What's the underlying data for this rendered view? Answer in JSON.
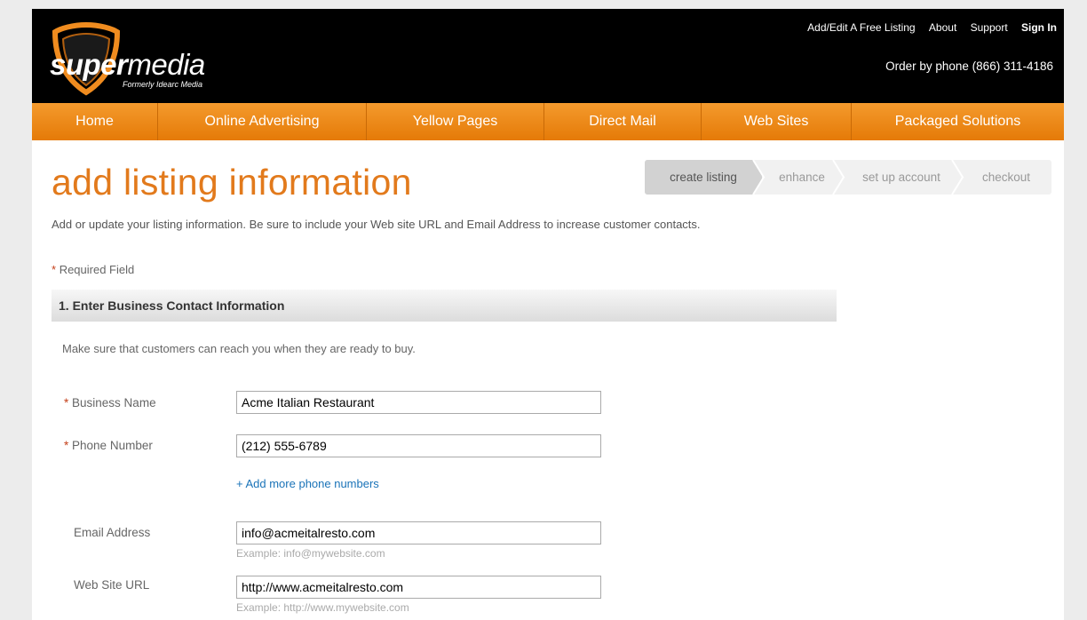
{
  "header": {
    "logo_bold": "super",
    "logo_thin": "media",
    "logo_tagline": "Formerly Idearc Media",
    "top_links": [
      "Add/Edit A Free Listing",
      "About",
      "Support",
      "Sign In"
    ],
    "phone": "Order by phone (866) 311-4186"
  },
  "nav": {
    "items": [
      "Home",
      "Online Advertising",
      "Yellow Pages",
      "Direct Mail",
      "Web Sites",
      "Packaged Solutions"
    ]
  },
  "page": {
    "title": "add listing information",
    "intro": "Add or update your listing information. Be sure to include your Web site URL and Email Address to increase customer contacts.",
    "required_star": "*",
    "required_note": "Required Field"
  },
  "steps": [
    "create listing",
    "enhance",
    "set up account",
    "checkout"
  ],
  "section": {
    "title": "1. Enter Business Contact Information",
    "description": "Make sure that customers can reach you when they are ready to buy."
  },
  "form": {
    "business_name": {
      "label": "Business Name",
      "value": "Acme Italian Restaurant",
      "required": true
    },
    "phone_number": {
      "label": "Phone Number",
      "value": "(212) 555-6789",
      "required": true
    },
    "add_phone_link": "+ Add more phone numbers",
    "email": {
      "label": "Email Address",
      "value": "info@acmeitalresto.com",
      "hint": "Example: info@mywebsite.com"
    },
    "website": {
      "label": "Web Site URL",
      "value": "http://www.acmeitalresto.com",
      "hint": "Example: http://www.mywebsite.com"
    }
  },
  "colors": {
    "brand_orange": "#e27a1c",
    "nav_orange": "#f08c1f",
    "link_blue": "#1a73b8",
    "required_red": "#c4401a"
  }
}
